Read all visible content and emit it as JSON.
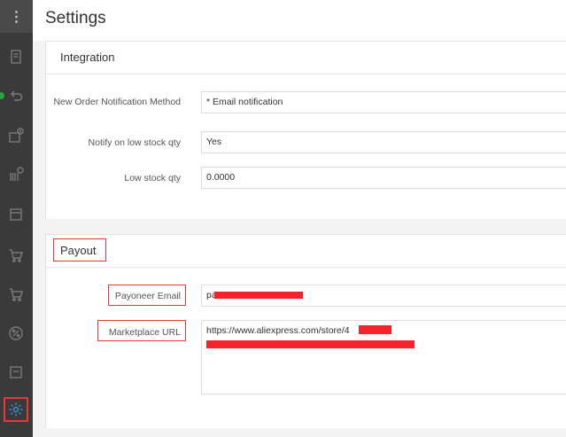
{
  "header": {
    "title": "Settings"
  },
  "sidebar": {
    "menu_glyph": "⋮",
    "icons": [
      "book-icon",
      "undo-icon",
      "download-icon",
      "barcode-download-icon",
      "archive-icon",
      "cart-icon",
      "cart-outline-icon",
      "percent-icon",
      "box-icon",
      "gear-icon"
    ],
    "active": "gear-icon"
  },
  "integration": {
    "title": "Integration",
    "fields": [
      {
        "label": "New Order Notification Method",
        "value": "* Email notification"
      },
      {
        "label": "Notify on low stock qty",
        "value": "Yes"
      },
      {
        "label": "Low stock qty",
        "value": "0.0000"
      }
    ]
  },
  "payout": {
    "title": "Payout",
    "payoneer_email": {
      "label": "Payoneer Email",
      "value": "pa"
    },
    "marketplace_url": {
      "label": "Marketplace URL",
      "value": "https://www.aliexpress.com/store/4"
    }
  },
  "colors": {
    "sidebar": "#3a3a3a",
    "highlight": "#e53935",
    "redaction": "#f4222a"
  }
}
